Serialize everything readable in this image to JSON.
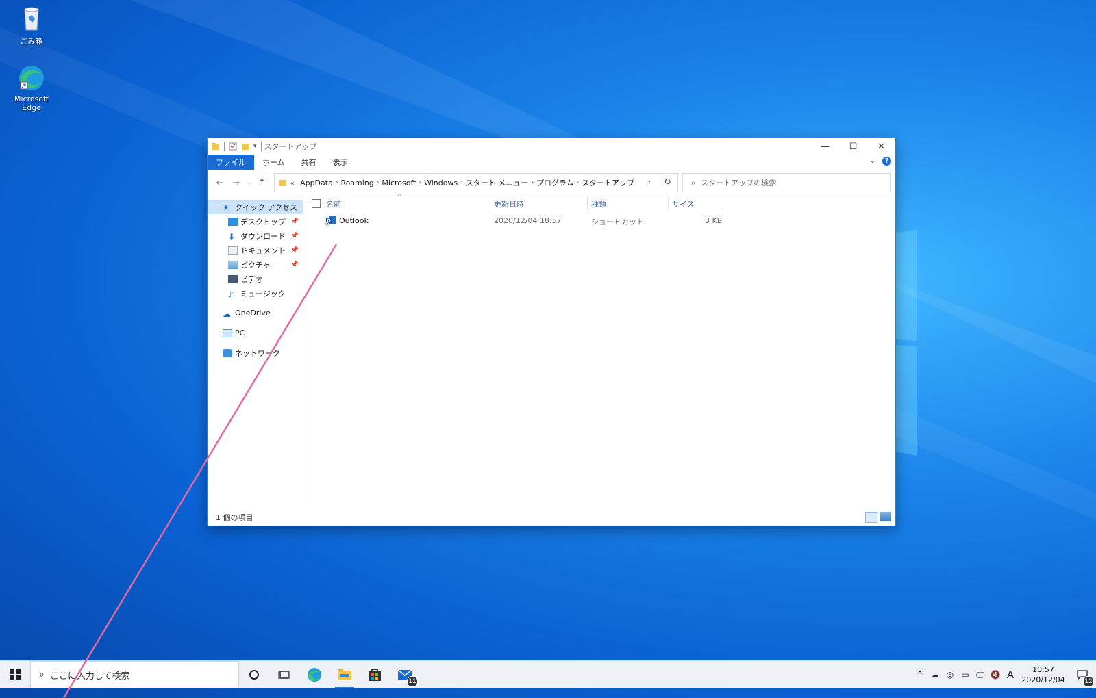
{
  "desktop": {
    "icons": [
      {
        "label": "ごみ箱"
      },
      {
        "label": "Microsoft Edge"
      }
    ]
  },
  "window": {
    "title": "スタートアップ",
    "ribbon_tabs": [
      "ファイル",
      "ホーム",
      "共有",
      "表示"
    ],
    "breadcrumb": [
      "AppData",
      "Roaming",
      "Microsoft",
      "Windows",
      "スタート メニュー",
      "プログラム",
      "スタートアップ"
    ],
    "breadcrumb_overflow": "«",
    "search_placeholder": "スタートアップの検索",
    "nav": {
      "quick_access": "クイック アクセス",
      "items": [
        {
          "label": "デスクトップ",
          "pinned": true
        },
        {
          "label": "ダウンロード",
          "pinned": true
        },
        {
          "label": "ドキュメント",
          "pinned": true
        },
        {
          "label": "ピクチャ",
          "pinned": true
        },
        {
          "label": "ビデオ",
          "pinned": false
        },
        {
          "label": "ミュージック",
          "pinned": false
        }
      ],
      "onedrive": "OneDrive",
      "pc": "PC",
      "network": "ネットワーク"
    },
    "columns": [
      "名前",
      "更新日時",
      "種類",
      "サイズ"
    ],
    "files": [
      {
        "name": "Outlook",
        "modified": "2020/12/04 18:57",
        "type": "ショートカット",
        "size": "3 KB"
      }
    ],
    "status": "1 個の項目"
  },
  "taskbar": {
    "search_placeholder": "ここに入力して検索",
    "mail_badge": "11",
    "ime": "A",
    "time": "10:57",
    "date": "2020/12/04",
    "notification_badge": "12"
  },
  "colors": {
    "accent": "#1a6bd4",
    "annotation_line": "#e26aa4"
  }
}
